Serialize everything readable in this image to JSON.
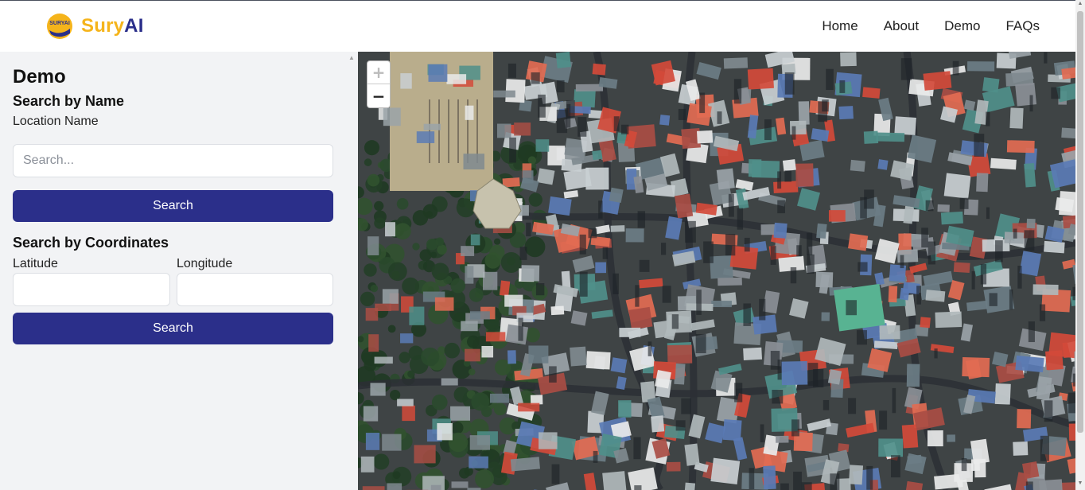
{
  "nav": {
    "brand_part1": "Sury",
    "brand_part2": "AI",
    "logo_text": "SURYAI",
    "links": [
      "Home",
      "About",
      "Demo",
      "FAQs"
    ]
  },
  "sidebar": {
    "title": "Demo",
    "name_section": {
      "heading": "Search by Name",
      "label": "Location Name",
      "placeholder": "Search...",
      "value": "",
      "button": "Search"
    },
    "coords_section": {
      "heading": "Search by Coordinates",
      "lat_label": "Latitude",
      "lon_label": "Longitude",
      "lat_value": "",
      "lon_value": "",
      "button": "Search"
    }
  },
  "map": {
    "type": "satellite",
    "zoom_in": "+",
    "zoom_out": "−"
  },
  "colors": {
    "primary": "#2b2f8a",
    "brand_yellow": "#f5b41b",
    "sidebar_bg": "#f2f3f5"
  }
}
